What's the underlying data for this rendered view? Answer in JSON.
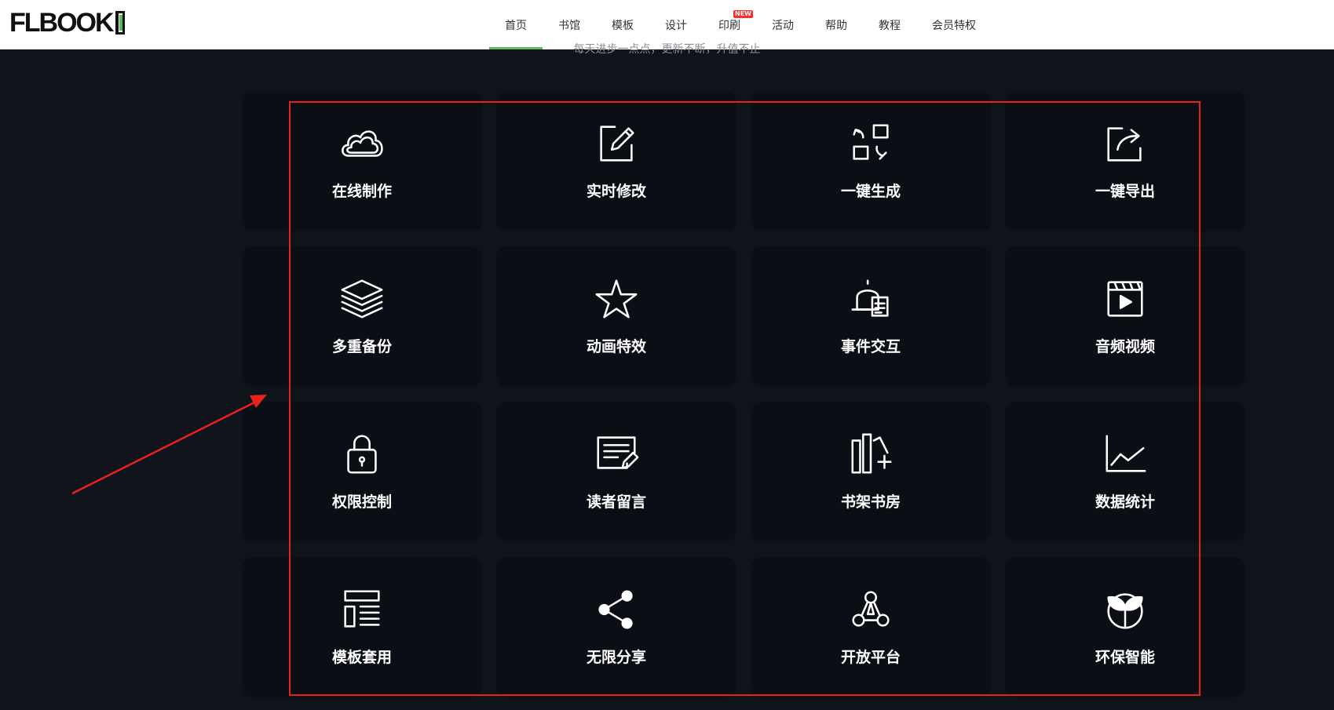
{
  "header": {
    "logo_text": "FLBOOK",
    "nav": [
      {
        "label": "首页",
        "active": true
      },
      {
        "label": "书馆"
      },
      {
        "label": "模板"
      },
      {
        "label": "设计"
      },
      {
        "label": "印刷",
        "badge": "NEW"
      },
      {
        "label": "活动"
      },
      {
        "label": "帮助"
      },
      {
        "label": "教程"
      },
      {
        "label": "会员特权"
      }
    ]
  },
  "subtitle": "每天进步一点点，更新不断，升值不止",
  "features": [
    {
      "label": "在线制作",
      "icon": "cloud-icon"
    },
    {
      "label": "实时修改",
      "icon": "edit-icon"
    },
    {
      "label": "一键生成",
      "icon": "generate-icon"
    },
    {
      "label": "一键导出",
      "icon": "export-icon"
    },
    {
      "label": "多重备份",
      "icon": "layers-icon"
    },
    {
      "label": "动画特效",
      "icon": "star-icon"
    },
    {
      "label": "事件交互",
      "icon": "bell-icon"
    },
    {
      "label": "音频视频",
      "icon": "video-icon"
    },
    {
      "label": "权限控制",
      "icon": "lock-icon"
    },
    {
      "label": "读者留言",
      "icon": "message-icon"
    },
    {
      "label": "书架书房",
      "icon": "bookshelf-icon"
    },
    {
      "label": "数据统计",
      "icon": "chart-icon"
    },
    {
      "label": "模板套用",
      "icon": "template-icon"
    },
    {
      "label": "无限分享",
      "icon": "share-icon"
    },
    {
      "label": "开放平台",
      "icon": "platform-icon"
    },
    {
      "label": "环保智能",
      "icon": "eco-icon"
    }
  ],
  "colors": {
    "highlight": "#e8231c",
    "accent": "#5cb85c",
    "badge": "#ff2a2a"
  }
}
